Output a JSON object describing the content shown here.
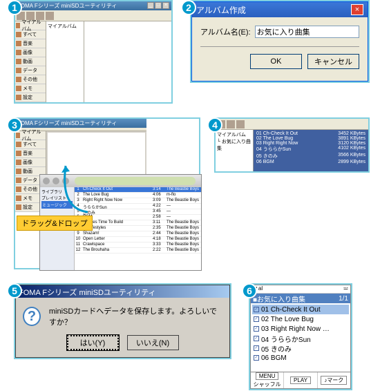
{
  "step1": {
    "title": "FOMA Fシリーズ miniSDユーティリティ",
    "sidebar": [
      "マイアルバム",
      "すべて",
      "音楽",
      "画像",
      "動画",
      "データ",
      "その他",
      "メモ",
      "設定"
    ],
    "tree": "マイアルバム"
  },
  "step2": {
    "title": "アルバム作成",
    "field_label": "アルバム名(E):",
    "field_value": "お気に入り曲集",
    "ok": "OK",
    "cancel": "キャンセル"
  },
  "step3": {
    "sticky": "ドラッグ&ドロップ",
    "itunes_tracks": [
      {
        "n": "1",
        "t": "Ch-Check It Out",
        "d": "3:14",
        "a": "The Beastie Boys"
      },
      {
        "n": "2",
        "t": "The Love Bug",
        "d": "4:06",
        "a": "m-flo"
      },
      {
        "n": "3",
        "t": "Right Right Now Now",
        "d": "3:09",
        "a": "The Beastie Boys"
      },
      {
        "n": "4",
        "t": "うららかSun",
        "d": "4:22",
        "a": "—"
      },
      {
        "n": "5",
        "t": "きのみ",
        "d": "3:45",
        "a": "—"
      },
      {
        "n": "6",
        "t": "BGM",
        "d": "2:58",
        "a": "—"
      },
      {
        "n": "7",
        "t": "It Takes Time To Build",
        "d": "3:11",
        "a": "The Beastie Boys"
      },
      {
        "n": "8",
        "t": "All Lifestyles",
        "d": "2:35",
        "a": "The Beastie Boys"
      },
      {
        "n": "9",
        "t": "Shazam!",
        "d": "2:44",
        "a": "The Beastie Boys"
      },
      {
        "n": "10",
        "t": "Open Letter",
        "d": "4:18",
        "a": "The Beastie Boys"
      },
      {
        "n": "11",
        "t": "Crawlspace",
        "d": "3:33",
        "a": "The Beastie Boys"
      },
      {
        "n": "12",
        "t": "The Brouhaha",
        "d": "2:22",
        "a": "The Beastie Boys"
      }
    ],
    "it_side": [
      "ライブラリ",
      "プレイリスト",
      "ミュージック"
    ]
  },
  "step4": {
    "tree": [
      "マイアルバム",
      "お気に入り曲集"
    ],
    "tracks": [
      {
        "t": "01 Ch-Check It Out",
        "s": "3452 KBytes"
      },
      {
        "t": "02 The Love Bug",
        "s": "3891 KBytes"
      },
      {
        "t": "03 Right Right Now",
        "s": "3120 KBytes"
      },
      {
        "t": "04 うららかSun",
        "s": "4102 KBytes"
      },
      {
        "t": "05 きのみ",
        "s": "3566 KBytes"
      },
      {
        "t": "06 BGM",
        "s": "2899 KBytes"
      }
    ]
  },
  "step5": {
    "title": "FOMA Fシリーズ miniSDユーティリティ",
    "msg": "miniSDカードへデータを保存します。よろしいですか？",
    "yes": "はい(Y)",
    "no": "いいえ(N)"
  },
  "step6": {
    "signal": "▼al",
    "batt": "𝌃",
    "header": "■お気に入り曲集",
    "page": "1/1",
    "items": [
      "01 Ch-Check It Out",
      "02 The Love Bug",
      "03 Right Right Now …",
      "04 うららかSun",
      "05 きのみ",
      "06 BGM"
    ],
    "sk": [
      [
        "MENU",
        "シャッフル"
      ],
      [
        "PLAY",
        ""
      ],
      [
        "♪マーク",
        ""
      ]
    ]
  }
}
